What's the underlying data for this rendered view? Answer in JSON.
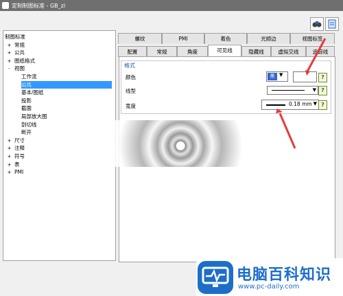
{
  "window": {
    "title": "定制制图标准 - GB_zl"
  },
  "tree": {
    "items": [
      {
        "label": "制图标准",
        "level": 0,
        "expander": ""
      },
      {
        "label": "常规",
        "level": 1,
        "expander": "+"
      },
      {
        "label": "公共",
        "level": 1,
        "expander": "+"
      },
      {
        "label": "图纸格式",
        "level": 1,
        "expander": "+"
      },
      {
        "label": "视图",
        "level": 1,
        "expander": "-"
      },
      {
        "label": "工作流",
        "level": 2,
        "expander": ""
      },
      {
        "label": "公共",
        "level": 2,
        "expander": "",
        "selected": true
      },
      {
        "label": "基本/图纸",
        "level": 2,
        "expander": ""
      },
      {
        "label": "投影",
        "level": 2,
        "expander": ""
      },
      {
        "label": "截面",
        "level": 2,
        "expander": ""
      },
      {
        "label": "局部放大图",
        "level": 2,
        "expander": ""
      },
      {
        "label": "剖切线",
        "level": 2,
        "expander": ""
      },
      {
        "label": "断开",
        "level": 2,
        "expander": ""
      },
      {
        "label": "尺寸",
        "level": 1,
        "expander": "+"
      },
      {
        "label": "注释",
        "level": 1,
        "expander": "+"
      },
      {
        "label": "符号",
        "level": 1,
        "expander": "+"
      },
      {
        "label": "表",
        "level": 1,
        "expander": "+"
      },
      {
        "label": "PMI",
        "level": 1,
        "expander": "+"
      }
    ]
  },
  "tabs": {
    "row1": [
      "螺纹",
      "PMI",
      "着色",
      "光顺边",
      "视图标签"
    ],
    "row2": [
      "配置",
      "常规",
      "角度",
      "可见线",
      "隐藏线",
      "虚拟交线",
      "追踪线"
    ],
    "active": "可见线"
  },
  "format": {
    "group_title": "格式",
    "color_label": "颜色",
    "linetype_label": "线型",
    "width_label": "宽度",
    "width_value": "0.18 mm",
    "help": "?"
  },
  "colors": {
    "accent": "#3399ff",
    "arrow": "#e63b3b",
    "brand": "#1d6ec9"
  },
  "watermark": {
    "title": "电脑百科知识",
    "url": "www.pc-daily.com"
  }
}
